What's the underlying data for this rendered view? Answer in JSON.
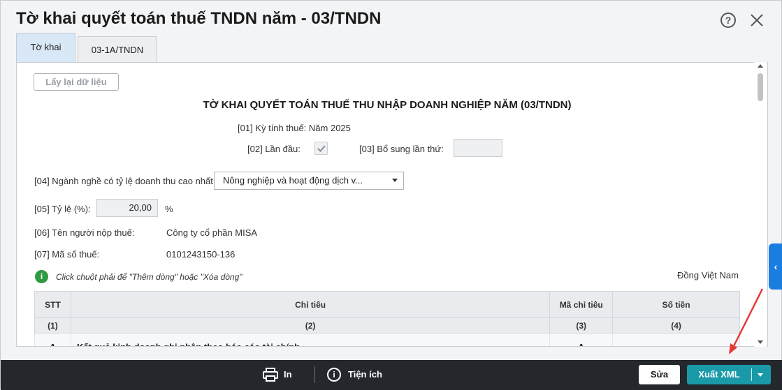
{
  "window": {
    "title": "Tờ khai quyết toán thuế TNDN năm - 03/TNDN",
    "tabs": [
      {
        "label": "Tờ khai",
        "active": true
      },
      {
        "label": "03-1A/TNDN",
        "active": false
      }
    ],
    "help_icon_glyph": "?"
  },
  "form": {
    "reload_button": "Lấy lại dữ liệu",
    "heading": "TỜ KHAI QUYẾT TOÁN THUẾ THU NHẬP DOANH NGHIỆP NĂM (03/TNDN)",
    "period_label": "[01] Kỳ tính thuế: Năm 2025",
    "first_time_label": "[02] Lần đầu:",
    "first_time_checked": true,
    "supplement_label": "[03] Bổ sung lần thứ:",
    "supplement_value": "",
    "industry_label": "[04] Ngành nghề có tỷ lệ doanh thu cao nhất:",
    "industry_value": "Nông nghiệp và hoạt động dịch v...",
    "ratio_label": "[05] Tỷ lệ (%):",
    "ratio_value": "20,00",
    "ratio_unit": "%",
    "taxpayer_label": "[06] Tên người nộp thuế:",
    "taxpayer_value": "Công ty cổ phần MISA",
    "taxcode_label": "[07] Mã số thuế:",
    "taxcode_value": "0101243150-136",
    "hint": "Click chuột phải để \"Thêm dòng\" hoặc \"Xóa dòng\"",
    "info_icon_glyph": "i",
    "currency": "Đồng Việt Nam"
  },
  "table": {
    "headers": [
      "STT",
      "Chỉ tiêu",
      "Mã chỉ tiêu",
      "Số tiền"
    ],
    "header_numbers": [
      "(1)",
      "(2)",
      "(3)",
      "(4)"
    ],
    "rows": [
      {
        "stt": "A",
        "name": "Kết quả kinh doanh ghi nhận theo báo cáo tài chính",
        "code": "A",
        "amount": ""
      }
    ]
  },
  "footer": {
    "print_label": "In",
    "utility_label": "Tiện ích",
    "utility_icon_glyph": "i",
    "edit_button": "Sửa",
    "export_button": "Xuất XML"
  },
  "side_toggle_glyph": "‹",
  "colors": {
    "accent": "#1a7de0",
    "export_button": "#1a9aa8",
    "footer_bg": "#24282d",
    "info_green": "#2e9b3f",
    "annotation_arrow": "#e53935"
  }
}
